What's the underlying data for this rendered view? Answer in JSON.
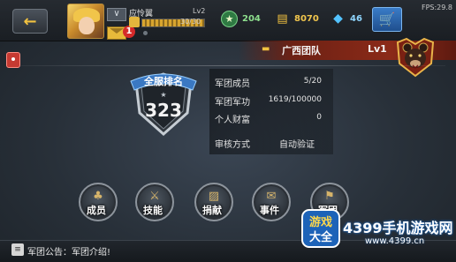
{
  "top_bar": {
    "player_name": "应怜翼",
    "player_level": "Lv2",
    "exp_text": "30/30",
    "exp_progress": 1.0,
    "mail_badge": "1",
    "resources": {
      "merit": "204",
      "gold": "8070",
      "diamond": "46"
    },
    "fps": "FPS:29.8"
  },
  "team": {
    "name": "广西团队",
    "level": "Lv1"
  },
  "rank": {
    "title": "全服排名",
    "value": "323"
  },
  "stats": [
    {
      "label": "军团成员",
      "value": "5/20"
    },
    {
      "label": "军团军功",
      "value": "1619/100000"
    },
    {
      "label": "个人财富",
      "value": "0"
    }
  ],
  "review": {
    "label": "审核方式",
    "value": "自动验证"
  },
  "actions": [
    {
      "label": "成员",
      "icon": "members-icon"
    },
    {
      "label": "技能",
      "icon": "skills-icon"
    },
    {
      "label": "捐献",
      "icon": "donate-icon"
    },
    {
      "label": "事件",
      "icon": "events-icon"
    },
    {
      "label": "军团",
      "icon": "legion-icon"
    }
  ],
  "announcement": {
    "text": "军团公告：军团介绍!"
  },
  "watermark": {
    "logo_text_top": "游戏",
    "logo_text_bottom": "大全",
    "title": "4399手机游戏网",
    "url": "www.4399.cn"
  },
  "colors": {
    "gold": "#f2c240",
    "team_banner": "#8b2a18",
    "diamond": "#53c3ff",
    "merit": "#2f7a43"
  }
}
